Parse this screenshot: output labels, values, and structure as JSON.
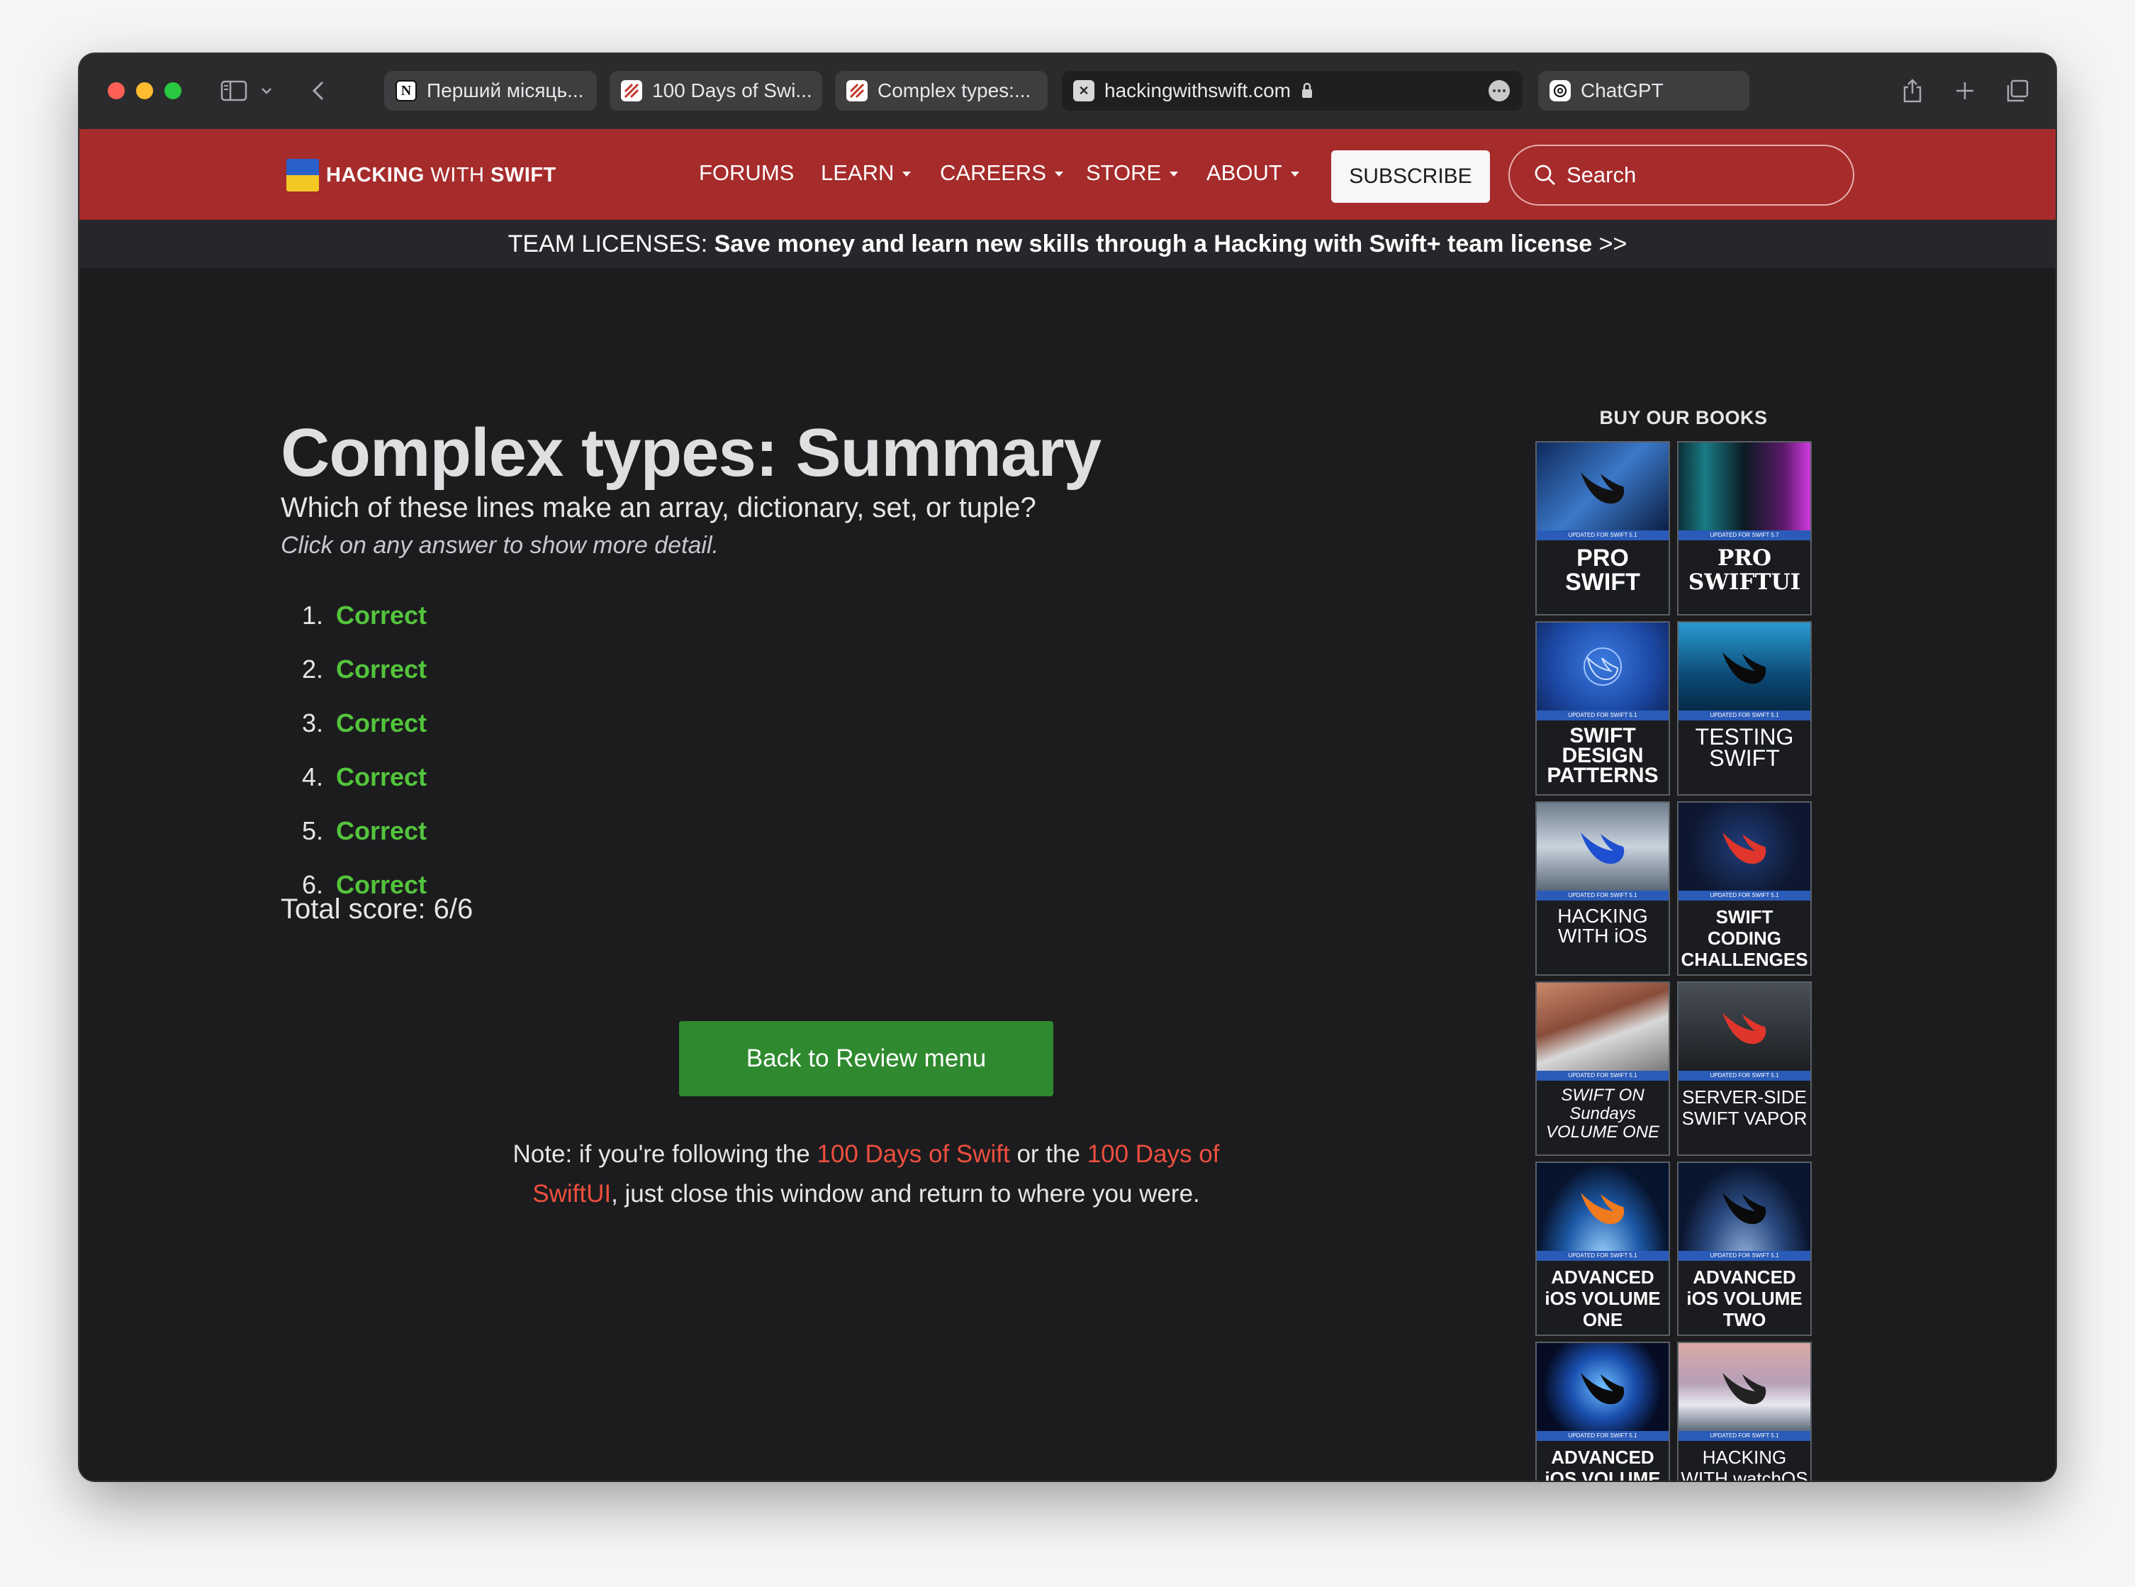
{
  "browser": {
    "tabs": [
      {
        "label": "Перший місяць..."
      },
      {
        "label": "100 Days of Swi..."
      },
      {
        "label": "Complex types:..."
      }
    ],
    "address": "hackingwithswift.com",
    "tab_extra": "ChatGPT"
  },
  "nav": {
    "logo_bold1": "HACKING",
    "logo_mid": " WITH ",
    "logo_bold2": "SWIFT",
    "links": [
      "FORUMS",
      "LEARN",
      "CAREERS",
      "STORE",
      "ABOUT"
    ],
    "subscribe": "SUBSCRIBE",
    "search_placeholder": "Search"
  },
  "banner": {
    "prefix": "TEAM LICENSES: ",
    "bold": "Save money and learn new skills through a Hacking with Swift+ team license",
    "suffix": " >>"
  },
  "main": {
    "title": "Complex types: Summary",
    "question": "Which of these lines make an array, dictionary, set, or tuple?",
    "hint": "Click on any answer to show more detail.",
    "answers": [
      {
        "num": "1.",
        "text": "Correct"
      },
      {
        "num": "2.",
        "text": "Correct"
      },
      {
        "num": "3.",
        "text": "Correct"
      },
      {
        "num": "4.",
        "text": "Correct"
      },
      {
        "num": "5.",
        "text": "Correct"
      },
      {
        "num": "6.",
        "text": "Correct"
      }
    ],
    "score": "Total score: 6/6",
    "back_button": "Back to Review menu",
    "note_1": "Note: if you're following the ",
    "note_link1": "100 Days of Swift",
    "note_2": " or the ",
    "note_link2": "100 Days of SwiftUI",
    "note_3": ", just close this window and return to where you were."
  },
  "sidebar": {
    "title": "BUY OUR BOOKS",
    "books": [
      {
        "title": "PRO SWIFT",
        "strip": "UPDATED FOR SWIFT 5.1"
      },
      {
        "title": "PRO SWIFTUI",
        "strip": "UPDATED FOR SWIFT 5.7"
      },
      {
        "title": "SWIFT DESIGN PATTERNS",
        "strip": "UPDATED FOR SWIFT 5.1"
      },
      {
        "title": "TESTING SWIFT",
        "strip": "UPDATED FOR SWIFT 5.1"
      },
      {
        "title": "HACKING WITH iOS",
        "strip": "UPDATED FOR SWIFT 5.1"
      },
      {
        "title": "SWIFT CODING CHALLENGES",
        "strip": "UPDATED FOR SWIFT 5.1"
      },
      {
        "title": "SWIFT ON Sundays VOLUME ONE",
        "strip": "UPDATED FOR SWIFT 5.1"
      },
      {
        "title": "SERVER-SIDE SWIFT VAPOR",
        "strip": "UPDATED FOR SWIFT 5.1"
      },
      {
        "title": "ADVANCED iOS VOLUME ONE",
        "strip": "UPDATED FOR SWIFT 5.1"
      },
      {
        "title": "ADVANCED iOS VOLUME TWO",
        "strip": "UPDATED FOR SWIFT 5.1"
      },
      {
        "title": "ADVANCED iOS VOLUME THREE",
        "strip": "UPDATED FOR SWIFT 5.1"
      },
      {
        "title": "HACKING WITH watchOS",
        "strip": "UPDATED FOR SWIFT 5.1"
      }
    ]
  },
  "colors": {
    "nav_red": "#a62b2b",
    "correct_green": "#54c43c",
    "button_green": "#2f8a2f",
    "link_red": "#ee4f3e"
  }
}
